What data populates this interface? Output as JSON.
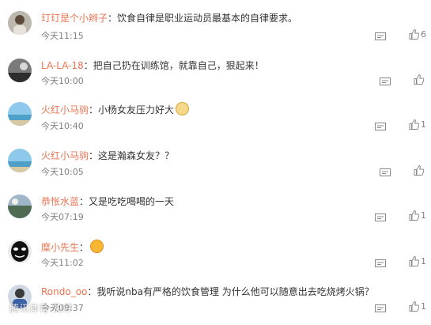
{
  "colon": "：",
  "comments": [
    {
      "user": "玎玎是个小辫子",
      "text": "饮食自律是职业运动员最基本的自律要求。",
      "time": "今天11:15",
      "likes": "6",
      "avatar": "avatar-person"
    },
    {
      "user": "LA-LA-18",
      "text": "把自己扔在训练馆，就靠自己，狠起来！",
      "time": "今天10:00",
      "likes": "",
      "avatar": "avatar-landscape-dark"
    },
    {
      "user": "火红小马驹",
      "text": "小杨女友压力好大",
      "time": "今天10:40",
      "likes": "1",
      "avatar": "avatar-sky-sea",
      "emoji": "cat-emoji"
    },
    {
      "user": "火红小马驹",
      "text": "这是瀚森女友？？",
      "time": "今天10:05",
      "likes": "",
      "avatar": "avatar-sky-sea"
    },
    {
      "user": "恭怅水蓝",
      "text": "又是吃吃喝喝的一天",
      "time": "今天07:19",
      "likes": "1",
      "avatar": "avatar-landscape"
    },
    {
      "user": "糜小先生",
      "text": "",
      "time": "今天11:02",
      "likes": "1",
      "avatar": "avatar-mask",
      "emoji": "laughing-emoji"
    },
    {
      "user": "Rondo_oo",
      "text": "我听说nba有严格的饮食管理 为什么他可以随意出去吃烧烤火锅？",
      "time": "今天09:37",
      "likes": "1",
      "avatar": "avatar-person-blue"
    }
  ],
  "watermark": "腾讯体育-热评"
}
